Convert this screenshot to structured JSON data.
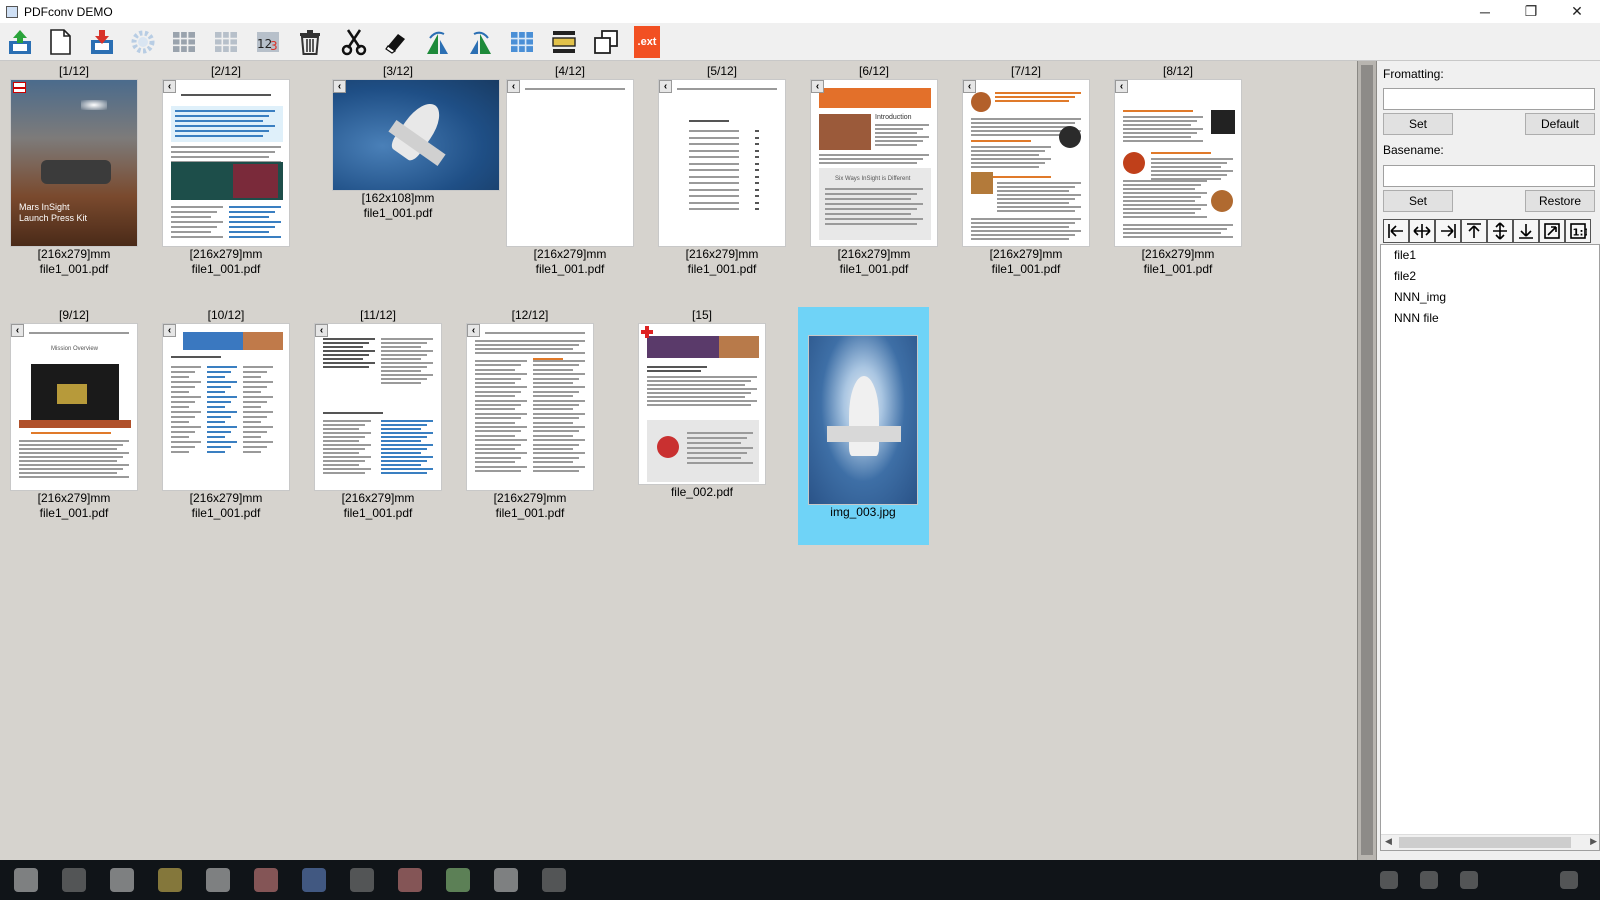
{
  "window": {
    "title": "PDFconv DEMO",
    "minimize": "─",
    "maximize": "❐",
    "close": "✕"
  },
  "toolbar": {
    "buttons": [
      "upload-icon",
      "new-page-icon",
      "save-download-icon",
      "settings-icon",
      "grid-icon",
      "grid-light-icon",
      "numbering-icon",
      "trash-icon",
      "cut-icon",
      "eraser-icon",
      "rotate-left-icon",
      "rotate-right-icon",
      "blue-grid-icon",
      "split-bar-icon",
      "copy-pages-icon",
      "ext-icon"
    ],
    "ext_label": ".ext"
  },
  "thumbnails": [
    {
      "index": "[1/12]",
      "size": "[216x279]mm",
      "file": "file1_001.pdf",
      "kind": "cover"
    },
    {
      "index": "[2/12]",
      "size": "[216x279]mm",
      "file": "file1_001.pdf",
      "kind": "text-blue"
    },
    {
      "index": "[3/12]",
      "size": "[162x108]mm",
      "file": "file1_001.pdf",
      "kind": "photo"
    },
    {
      "index": "[4/12]",
      "size": "[216x279]mm",
      "file": "file1_001.pdf",
      "kind": "blank"
    },
    {
      "index": "[5/12]",
      "size": "[216x279]mm",
      "file": "file1_001.pdf",
      "kind": "toc"
    },
    {
      "index": "[6/12]",
      "size": "[216x279]mm",
      "file": "file1_001.pdf",
      "kind": "intro"
    },
    {
      "index": "[7/12]",
      "size": "[216x279]mm",
      "file": "file1_001.pdf",
      "kind": "text-orange"
    },
    {
      "index": "[8/12]",
      "size": "[216x279]mm",
      "file": "file1_001.pdf",
      "kind": "text-orange2"
    },
    {
      "index": "[9/12]",
      "size": "[216x279]mm",
      "file": "file1_001.pdf",
      "kind": "mission"
    },
    {
      "index": "[10/12]",
      "size": "[216x279]mm",
      "file": "file1_001.pdf",
      "kind": "contacts"
    },
    {
      "index": "[11/12]",
      "size": "[216x279]mm",
      "file": "file1_001.pdf",
      "kind": "list"
    },
    {
      "index": "[12/12]",
      "size": "[216x279]mm",
      "file": "file1_001.pdf",
      "kind": "columns"
    },
    {
      "index": "[15]",
      "size": "",
      "file": "file_002.pdf",
      "kind": "mission2"
    },
    {
      "index": "",
      "size": "",
      "file": "img_003.jpg",
      "kind": "image",
      "selected": true
    }
  ],
  "page_text": {
    "cover_title": "Mars InSight",
    "cover_subtitle": "Launch Press Kit",
    "intro_heading": "Introduction",
    "mission_heading": "Mission Overview",
    "intro_box_heading": "Six Ways InSight is Different"
  },
  "panel": {
    "formatting_label": "Fromatting:",
    "formatting_value": "",
    "set_label": "Set",
    "default_label": "Default",
    "basename_label": "Basename:",
    "basename_value": "",
    "set2_label": "Set",
    "restore_label": "Restore",
    "tools": [
      "align-left-icon",
      "align-center-h-icon",
      "align-right-icon",
      "align-top-icon",
      "align-center-v-icon",
      "align-bottom-icon",
      "fit-icon",
      "actual-size-icon"
    ],
    "list": [
      "file1",
      "file2",
      "NNN_img",
      "NNN file"
    ]
  },
  "colors": {
    "selection": "#6fd3f7",
    "accent_orange": "#e07a2a",
    "ext_button": "#f25022"
  }
}
